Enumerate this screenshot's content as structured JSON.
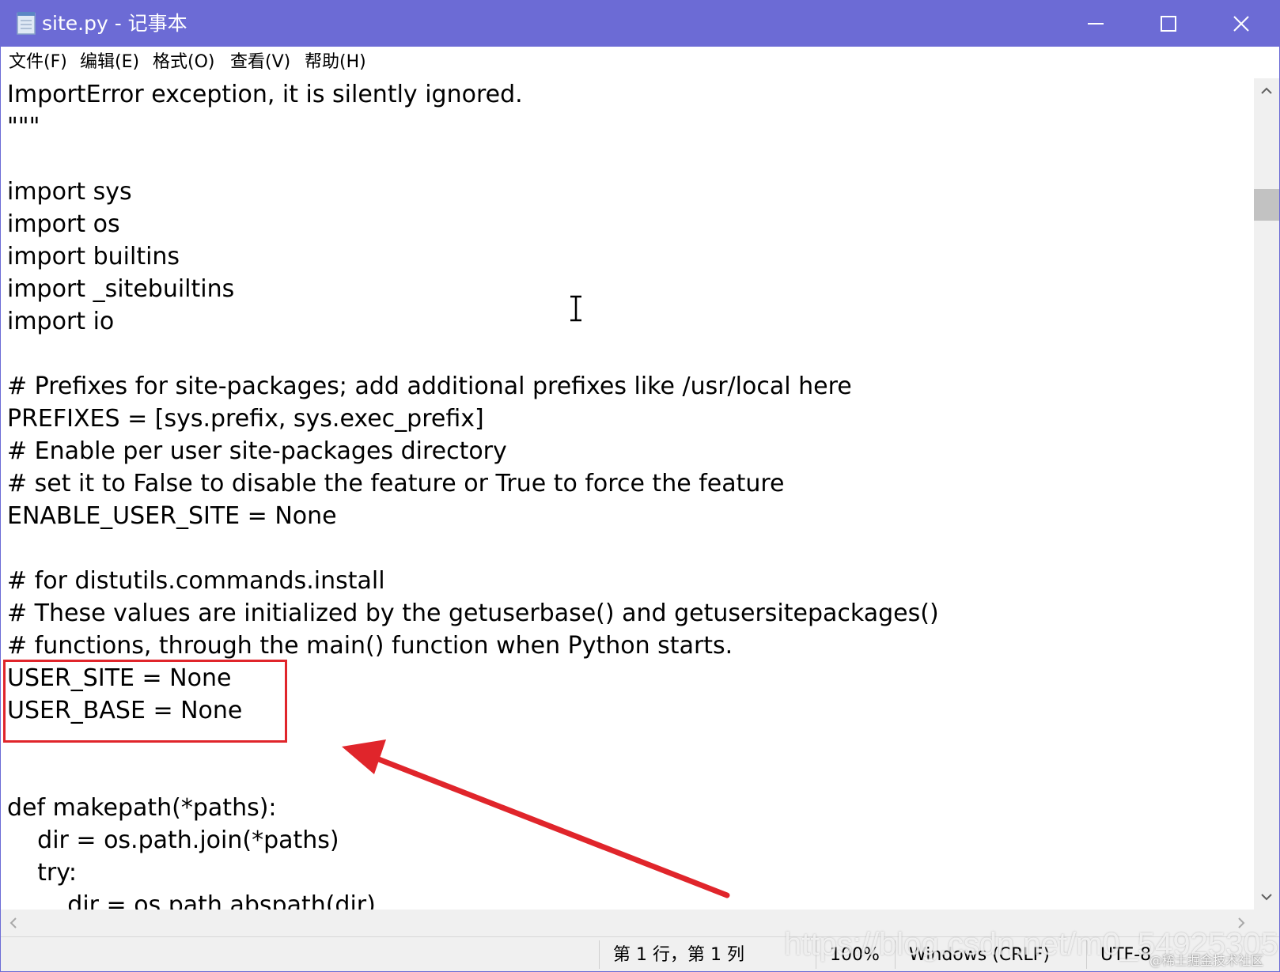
{
  "window": {
    "title": "site.py - 记事本",
    "controls": {
      "minimize": "minimize",
      "maximize": "maximize",
      "close": "close"
    }
  },
  "menu": {
    "items": [
      {
        "label": "文件(F)"
      },
      {
        "label": "编辑(E)"
      },
      {
        "label": "格式(O)"
      },
      {
        "label": "查看(V)"
      },
      {
        "label": "帮助(H)"
      }
    ]
  },
  "editor": {
    "lines": [
      "ImportError exception, it is silently ignored.",
      "\"\"\"",
      "",
      "import sys",
      "import os",
      "import builtins",
      "import _sitebuiltins",
      "import io",
      "",
      "# Prefixes for site-packages; add additional prefixes like /usr/local here",
      "PREFIXES = [sys.prefix, sys.exec_prefix]",
      "# Enable per user site-packages directory",
      "# set it to False to disable the feature or True to force the feature",
      "ENABLE_USER_SITE = None",
      "",
      "# for distutils.commands.install",
      "# These values are initialized by the getuserbase() and getusersitepackages()",
      "# functions, through the main() function when Python starts.",
      "USER_SITE = None",
      "USER_BASE = None",
      "",
      "",
      "def makepath(*paths):",
      "    dir = os.path.join(*paths)",
      "    try:",
      "        dir = os.path.abspath(dir)"
    ],
    "annotation": {
      "box_color": "#e0252b",
      "arrow_color": "#e0252b"
    }
  },
  "status": {
    "position": "第 1 行，第 1 列",
    "zoom": "100%",
    "line_ending": "Windows (CRLF)",
    "encoding": "UTF-8"
  },
  "watermarks": {
    "url": "https://blog.csdn.net/m0_54925305",
    "juejin": "@稀土掘金技术社区"
  },
  "colors": {
    "titlebar": "#6c6bd5",
    "annotation": "#e0252b"
  }
}
